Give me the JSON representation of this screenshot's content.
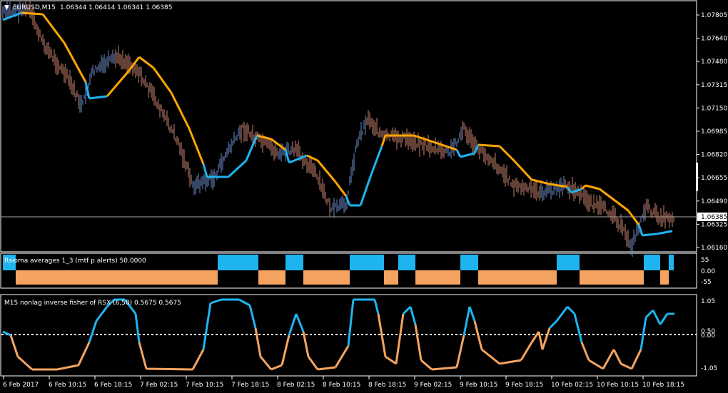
{
  "chart": {
    "symbol_label": "EURUSD,M15",
    "ohlc": "1.06344 1.06414 1.06341 1.06385",
    "current_price": "1.06385",
    "price_axis": [
      "1.07805",
      "1.07640",
      "1.07480",
      "1.07315",
      "1.07150",
      "1.06985",
      "1.06820",
      "1.06655",
      "1.06490",
      "1.06325",
      "1.06160"
    ],
    "time_axis": [
      "6 Feb 2017",
      "6 Feb 10:15",
      "6 Feb 18:15",
      "7 Feb 02:15",
      "7 Feb 10:15",
      "7 Feb 18:15",
      "8 Feb 02:15",
      "8 Feb 10:15",
      "8 Feb 18:15",
      "9 Feb 02:15",
      "9 Feb 10:15",
      "9 Feb 18:15",
      "10 Feb 02:15",
      "10 Feb 10:15",
      "10 Feb 18:15"
    ]
  },
  "indicator1": {
    "title": "Rsioma averages 1_3 (mtf p alerts) 50.0000",
    "axis": [
      "55",
      "0.00",
      "-55"
    ]
  },
  "indicator2": {
    "title": "M15 nonlag inverse fisher of RSX (6,50) 0.5675 0.5675",
    "axis": [
      "1.05",
      "0.50",
      "0.00",
      "-1.05"
    ]
  },
  "colors": {
    "background": "#000000",
    "up": "#1EB4F0",
    "down": "#F4A460",
    "ma": "#FFA500",
    "bar_up": "#6E8CC8",
    "bar_down": "#C8826E",
    "grid": "#FFFFFF"
  }
}
